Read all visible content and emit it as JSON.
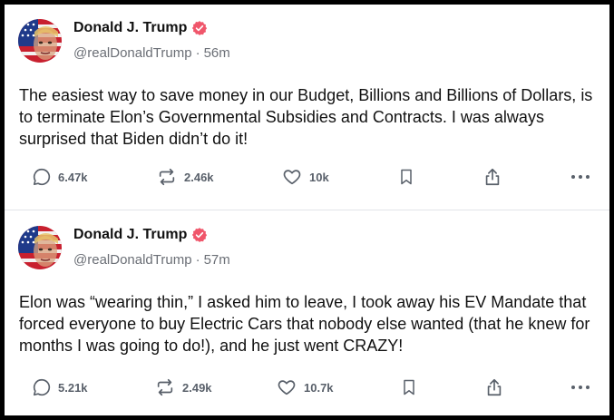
{
  "posts": [
    {
      "author_name": "Donald J. Trump",
      "handle": "@realDonaldTrump",
      "separator": "·",
      "time": "56m",
      "text": "The easiest way to save money in our Budget, Billions and Billions of Dollars, is to terminate Elon’s Governmental Subsidies and Contracts. I was always surprised that Biden didn’t do it!",
      "replies": "6.47k",
      "reposts": "2.46k",
      "likes": "10k"
    },
    {
      "author_name": "Donald J. Trump",
      "handle": "@realDonaldTrump",
      "separator": "·",
      "time": "57m",
      "text": "Elon was “wearing thin,” I asked him to leave, I took away his EV Mandate that forced everyone to buy Electric Cars that nobody else wanted (that he knew for months I was going to do!), and he just went CRAZY!",
      "replies": "5.21k",
      "reposts": "2.49k",
      "likes": "10.7k"
    }
  ],
  "icons": {
    "verified": "verified-badge-icon",
    "reply": "reply-icon",
    "repost": "repost-icon",
    "like": "heart-icon",
    "bookmark": "bookmark-icon",
    "share": "share-icon",
    "more": "more-icon"
  },
  "colors": {
    "verified_badge": "#f0566b",
    "icon_gray": "#59606a",
    "handle_gray": "#6b6f76",
    "text": "#111111"
  }
}
